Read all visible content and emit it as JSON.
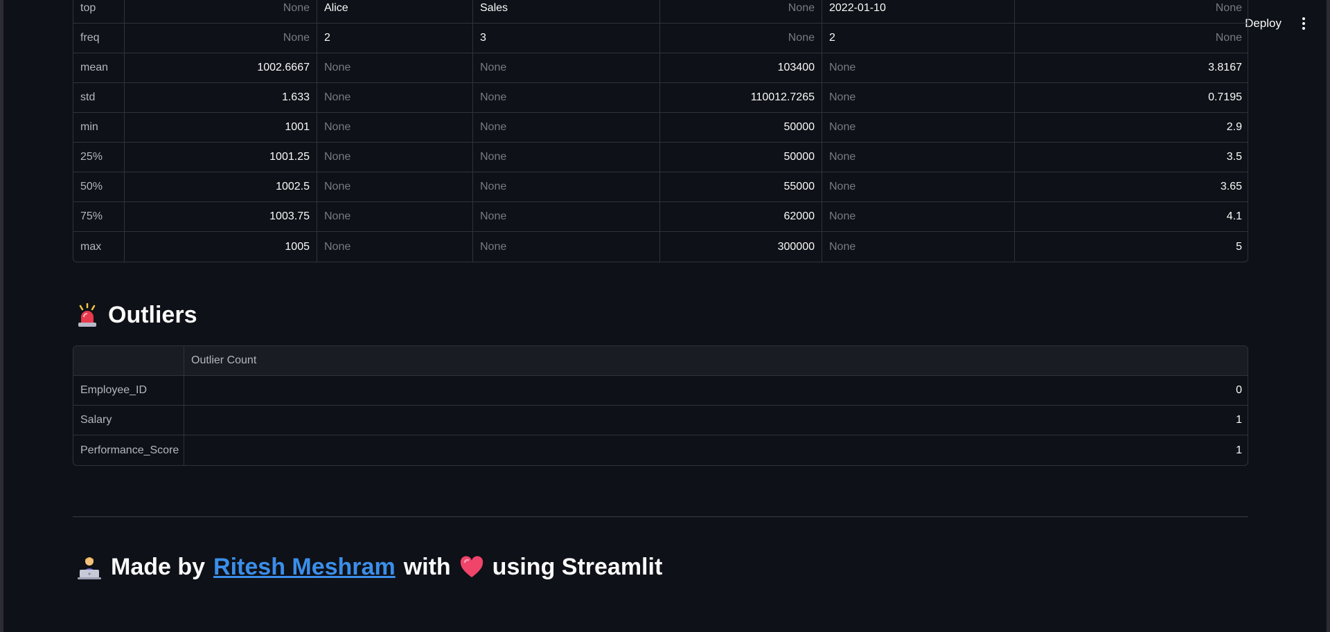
{
  "header": {
    "deploy_label": "Deploy"
  },
  "describe_table": {
    "rows": [
      {
        "index": "top",
        "c1": "None",
        "c2": "Alice",
        "c3": "Sales",
        "c4": "None",
        "c5": "2022-01-10",
        "c6": "None"
      },
      {
        "index": "freq",
        "c1": "None",
        "c2": "2",
        "c3": "3",
        "c4": "None",
        "c5": "2",
        "c6": "None"
      },
      {
        "index": "mean",
        "c1": "1002.6667",
        "c2": "None",
        "c3": "None",
        "c4": "103400",
        "c5": "None",
        "c6": "3.8167"
      },
      {
        "index": "std",
        "c1": "1.633",
        "c2": "None",
        "c3": "None",
        "c4": "110012.7265",
        "c5": "None",
        "c6": "0.7195"
      },
      {
        "index": "min",
        "c1": "1001",
        "c2": "None",
        "c3": "None",
        "c4": "50000",
        "c5": "None",
        "c6": "2.9"
      },
      {
        "index": "25%",
        "c1": "1001.25",
        "c2": "None",
        "c3": "None",
        "c4": "50000",
        "c5": "None",
        "c6": "3.5"
      },
      {
        "index": "50%",
        "c1": "1002.5",
        "c2": "None",
        "c3": "None",
        "c4": "55000",
        "c5": "None",
        "c6": "3.65"
      },
      {
        "index": "75%",
        "c1": "1003.75",
        "c2": "None",
        "c3": "None",
        "c4": "62000",
        "c5": "None",
        "c6": "4.1"
      },
      {
        "index": "max",
        "c1": "1005",
        "c2": "None",
        "c3": "None",
        "c4": "300000",
        "c5": "None",
        "c6": "5"
      }
    ]
  },
  "outliers": {
    "title": "Outliers",
    "icon": "siren-icon",
    "column_header": "Outlier Count",
    "rows": [
      {
        "index": "Employee_ID",
        "count": "0"
      },
      {
        "index": "Salary",
        "count": "1"
      },
      {
        "index": "Performance_Score",
        "count": "1"
      }
    ]
  },
  "footer": {
    "prefix": "Made by",
    "link_text": "Ritesh Meshram",
    "middle": "with",
    "suffix": "using Streamlit",
    "icons": [
      "technologist-icon",
      "heart-icon"
    ]
  },
  "colors": {
    "background": "#0e1117",
    "link": "#3b8eea",
    "muted": "#797b83",
    "border": "#30333b"
  }
}
